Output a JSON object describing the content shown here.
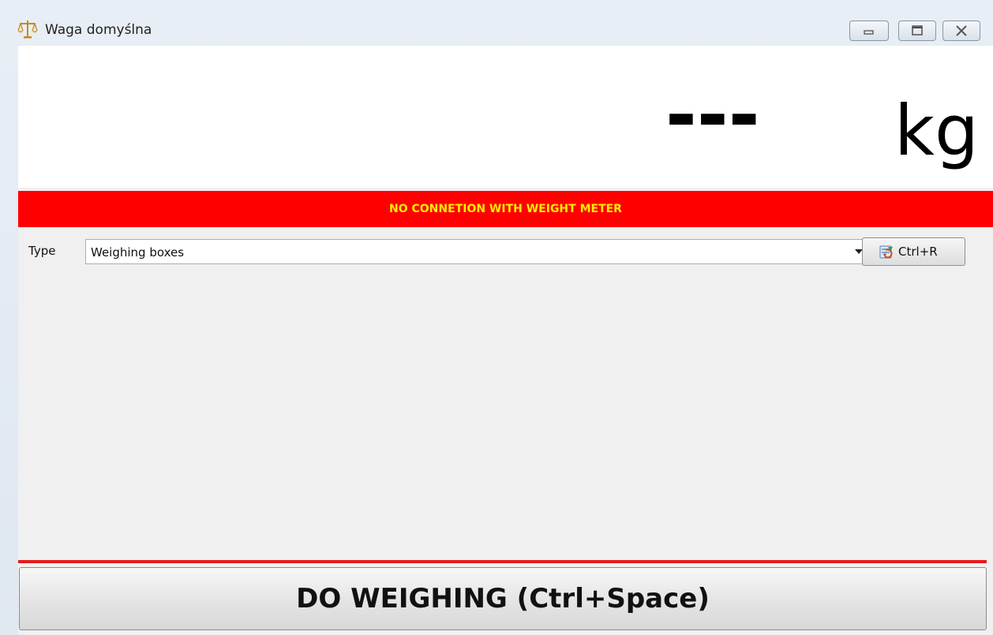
{
  "window": {
    "title": "Waga domyślna"
  },
  "display": {
    "weight_value": "---",
    "unit": "kg"
  },
  "status": {
    "message": "NO CONNETION WITH WEIGHT METER",
    "background": "#fe0000",
    "text_color": "#ffee00"
  },
  "type_field": {
    "label": "Type",
    "selected": "Weighing boxes"
  },
  "refresh_button": {
    "label": "Ctrl+R",
    "icon": "refresh-icon"
  },
  "weigh_button": {
    "label": "DO WEIGHING (Ctrl+Space)"
  },
  "icons": {
    "app": "scale-icon",
    "minimize": "minimize-icon",
    "maximize": "maximize-icon",
    "close": "close-icon"
  }
}
